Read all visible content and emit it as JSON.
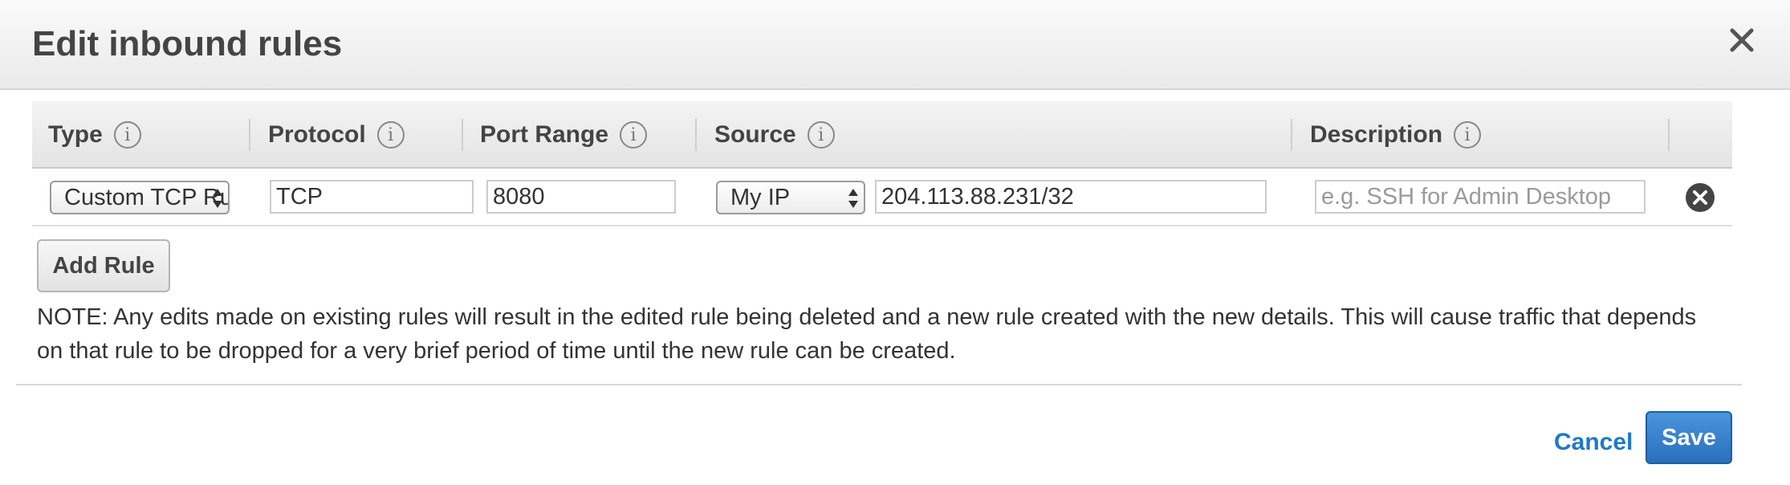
{
  "dialog": {
    "title": "Edit inbound rules"
  },
  "table": {
    "columns": [
      {
        "label": "Type",
        "info_icon": "info-icon"
      },
      {
        "label": "Protocol",
        "info_icon": "info-icon"
      },
      {
        "label": "Port Range",
        "info_icon": "info-icon"
      },
      {
        "label": "Source",
        "info_icon": "info-icon"
      },
      {
        "label": "Description",
        "info_icon": "info-icon"
      }
    ],
    "rows": [
      {
        "type": "Custom TCP Rule",
        "protocol": "TCP",
        "port_range": "8080",
        "source_type": "My IP",
        "source_cidr": "204.113.88.231/32",
        "description_value": "",
        "description_placeholder": "e.g. SSH for Admin Desktop",
        "remove_icon": "remove-circle-icon"
      }
    ]
  },
  "actions": {
    "add_rule_label": "Add Rule",
    "cancel_label": "Cancel",
    "save_label": "Save"
  },
  "note": "NOTE: Any edits made on existing rules will result in the edited rule being deleted and a new rule created with the new details. This will cause traffic that depends on that rule to be dropped for a very brief period of time until the new rule can be created.",
  "colors": {
    "link": "#1f79c4",
    "primary_button": "#2a6fbd"
  }
}
